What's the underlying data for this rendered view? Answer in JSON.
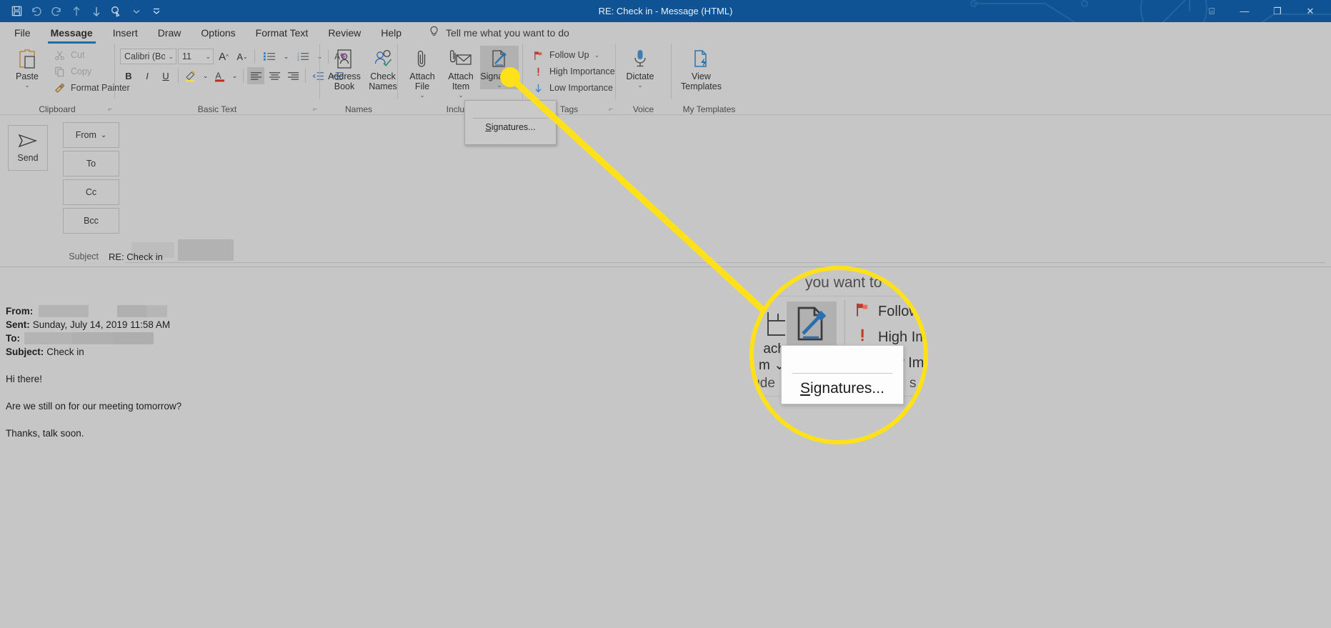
{
  "window": {
    "title": "RE: Check in  -  Message (HTML)",
    "controls": [
      {
        "name": "ribbon-display-options",
        "glyph": "⌸"
      },
      {
        "name": "minimize",
        "glyph": "—"
      },
      {
        "name": "restore",
        "glyph": "❐"
      },
      {
        "name": "close",
        "glyph": "✕"
      }
    ]
  },
  "quick_access": [
    {
      "name": "save-icon",
      "label": "Save"
    },
    {
      "name": "undo-icon",
      "label": "Undo"
    },
    {
      "name": "redo-icon",
      "label": "Redo"
    },
    {
      "name": "previous-item-icon",
      "label": "Previous Item"
    },
    {
      "name": "next-item-icon",
      "label": "Next Item"
    },
    {
      "name": "touch-mode-icon",
      "label": "Touch/Mouse Mode"
    },
    {
      "name": "customize-qat-icon",
      "label": "Customize Quick Access Toolbar"
    }
  ],
  "tabs": [
    {
      "label": "File",
      "active": false
    },
    {
      "label": "Message",
      "active": true
    },
    {
      "label": "Insert",
      "active": false
    },
    {
      "label": "Draw",
      "active": false
    },
    {
      "label": "Options",
      "active": false
    },
    {
      "label": "Format Text",
      "active": false
    },
    {
      "label": "Review",
      "active": false
    },
    {
      "label": "Help",
      "active": false
    }
  ],
  "tell_me": {
    "icon": "lightbulb-icon",
    "placeholder": "Tell me what you want to do"
  },
  "ribbon": {
    "groups": [
      {
        "label": "Clipboard",
        "has_dialog_launcher": true
      },
      {
        "label": "Basic Text",
        "has_dialog_launcher": true
      },
      {
        "label": "Names",
        "has_dialog_launcher": false
      },
      {
        "label": "Include",
        "has_dialog_launcher": false
      },
      {
        "label": "Tags",
        "has_dialog_launcher": true
      },
      {
        "label": "Voice",
        "has_dialog_launcher": false
      },
      {
        "label": "My Templates",
        "has_dialog_launcher": false
      }
    ],
    "clipboard": {
      "paste": "Paste",
      "cut": "Cut",
      "copy": "Copy",
      "format_painter": "Format Painter"
    },
    "basic_text": {
      "font_name": "Calibri (Bod",
      "font_size": "11",
      "grow_font": "A",
      "shrink_font": "A",
      "bold": "B",
      "italic": "I",
      "underline": "U",
      "bullets": "bullet-list-icon",
      "numbering": "numbered-list-icon",
      "clear_formatting": "clear-formatting-icon",
      "text_highlight": "text-highlight-icon",
      "font_color": "font-color-icon",
      "align_left": "align-left-icon",
      "align_center": "align-center-icon",
      "align_right": "align-right-icon",
      "decrease_indent": "decrease-indent-icon",
      "increase_indent": "increase-indent-icon"
    },
    "names": {
      "address_book": "Address\nBook",
      "check_names": "Check\nNames"
    },
    "include": {
      "attach_file": "Attach\nFile",
      "attach_item": "Attach\nItem",
      "signature": "Signature"
    },
    "tags": {
      "follow_up": "Follow Up",
      "high_importance": "High Importance",
      "low_importance": "Low Importance"
    },
    "voice": {
      "dictate": "Dictate"
    },
    "my_templates": {
      "view_templates": "View\nTemplates"
    }
  },
  "signature_menu": {
    "items": [
      {
        "label": "Signatures...",
        "accel": "S"
      }
    ]
  },
  "compose": {
    "send_button": "Send",
    "fields": [
      {
        "name": "from",
        "label": "From",
        "has_dropdown": true,
        "value": ""
      },
      {
        "name": "to",
        "label": "To",
        "has_dropdown": false,
        "value": ""
      },
      {
        "name": "cc",
        "label": "Cc",
        "has_dropdown": false,
        "value": ""
      },
      {
        "name": "bcc",
        "label": "Bcc",
        "has_dropdown": false,
        "value": ""
      }
    ],
    "subject_label": "Subject",
    "subject_value": "RE: Check in"
  },
  "message_body": {
    "quoted_header": {
      "from_label": "From:",
      "from_value": "",
      "sent_label": "Sent:",
      "sent_value": "Sunday, July 14, 2019 11:58 AM",
      "to_label": "To:",
      "to_value": "",
      "subject_label": "Subject:",
      "subject_value": "Check in"
    },
    "paragraphs": [
      "Hi there!",
      "Are we still on for our meeting tomorrow?",
      "Thanks, talk soon."
    ]
  },
  "callout": {
    "highlight_color": "#ffe11a",
    "magnified": {
      "tell_me_fragment": "you want to",
      "attach_label_top": "ach",
      "attach_label_bottom": "m",
      "signature_label": "Signature",
      "follow_up": "Follow",
      "high_importance": "High Imp",
      "low_importance": "Low Impo",
      "group_left": "lude",
      "group_right": "s",
      "menu_item": "Signatures..."
    }
  },
  "colors": {
    "titlebar": "#0f5394",
    "ribbon": "#c6c6c6",
    "accent": "#1c6ea8",
    "highlight": "#ffe11a"
  }
}
